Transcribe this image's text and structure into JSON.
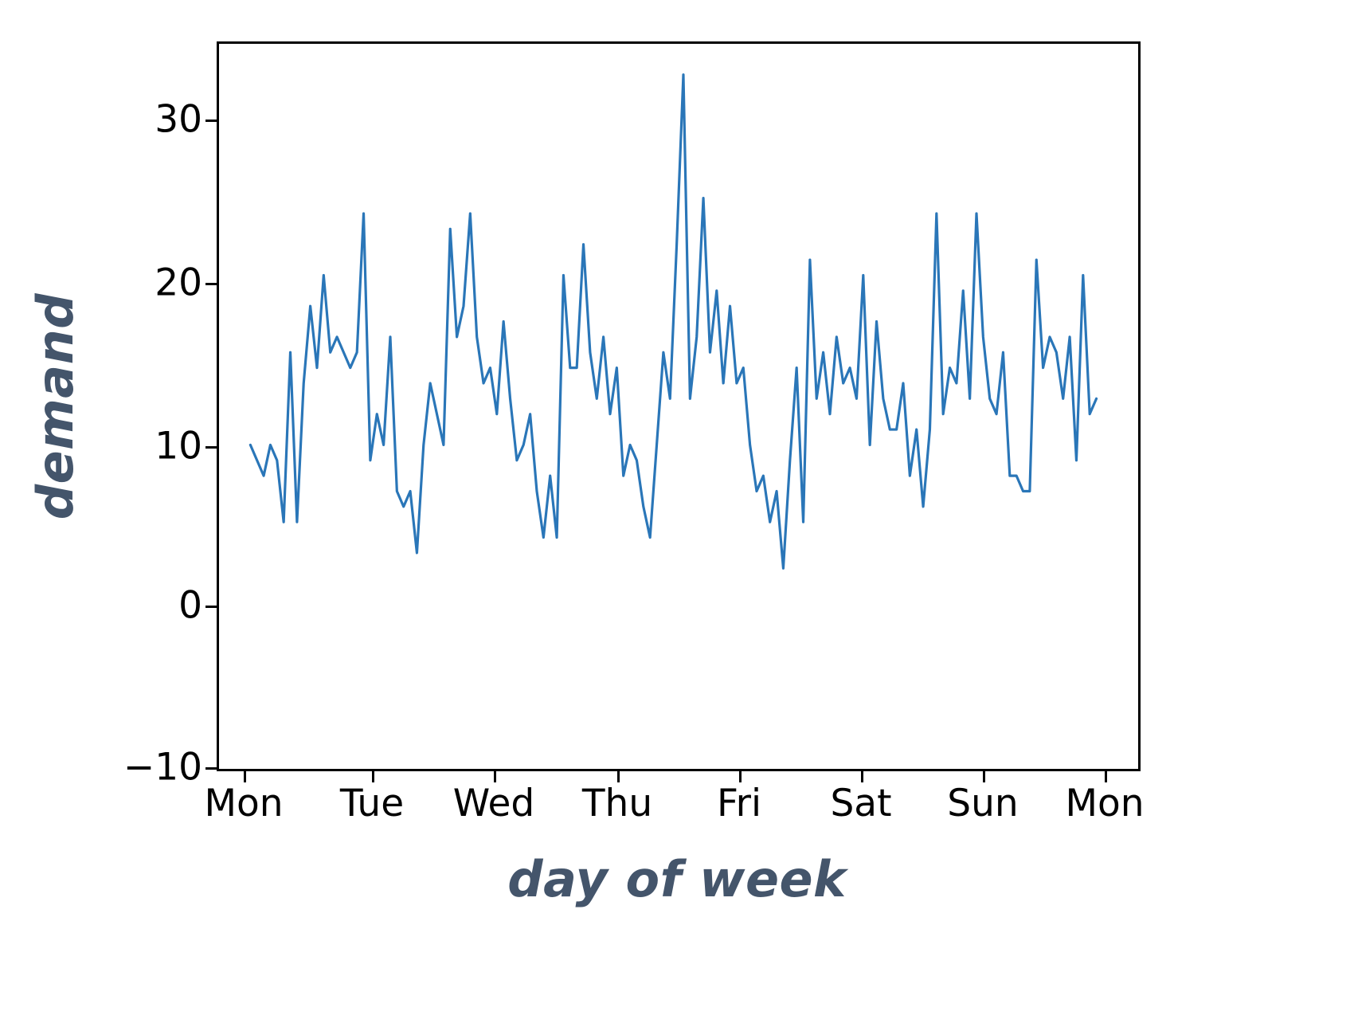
{
  "chart_data": {
    "type": "line",
    "title": "",
    "xlabel": "day of week",
    "ylabel": "demand",
    "xtick_labels": [
      "Mon",
      "Tue",
      "Wed",
      "Thu",
      "Fri",
      "Sat",
      "Sun",
      "Mon"
    ],
    "ytick_labels": [
      "30",
      "20",
      "10",
      "0",
      "−10"
    ],
    "ytick_values": [
      30,
      20,
      10,
      0,
      -10
    ],
    "ylim": [
      -12,
      35
    ],
    "xlim": [
      -4,
      172
    ],
    "grid": false,
    "legend": null,
    "line_color": "#2a76b8",
    "line_width": 3.2,
    "series": [
      {
        "name": "demand",
        "x_unit": "hour",
        "values": [
          9,
          8,
          7,
          9,
          8,
          4,
          15,
          4,
          13,
          18,
          14,
          20,
          15,
          16,
          15,
          14,
          15,
          24,
          8,
          11,
          9,
          16,
          6,
          5,
          6,
          2,
          9,
          13,
          11,
          9,
          23,
          16,
          18,
          24,
          16,
          13,
          14,
          11,
          17,
          12,
          8,
          9,
          11,
          6,
          3,
          7,
          3,
          20,
          14,
          14,
          22,
          15,
          12,
          16,
          11,
          14,
          7,
          9,
          8,
          5,
          3,
          9,
          15,
          12,
          22,
          33,
          12,
          16,
          25,
          15,
          19,
          13,
          18,
          13,
          14,
          9,
          6,
          7,
          4,
          6,
          1,
          8,
          14,
          4,
          21,
          12,
          15,
          11,
          16,
          13,
          14,
          12,
          20,
          9,
          17,
          12,
          10,
          10,
          13,
          7,
          10,
          5,
          10,
          24,
          11,
          14,
          13,
          19,
          12,
          24,
          16,
          12,
          11,
          15,
          7,
          7,
          6,
          6,
          21,
          14,
          16,
          15,
          12,
          16,
          8,
          20,
          11,
          12
        ]
      }
    ]
  }
}
